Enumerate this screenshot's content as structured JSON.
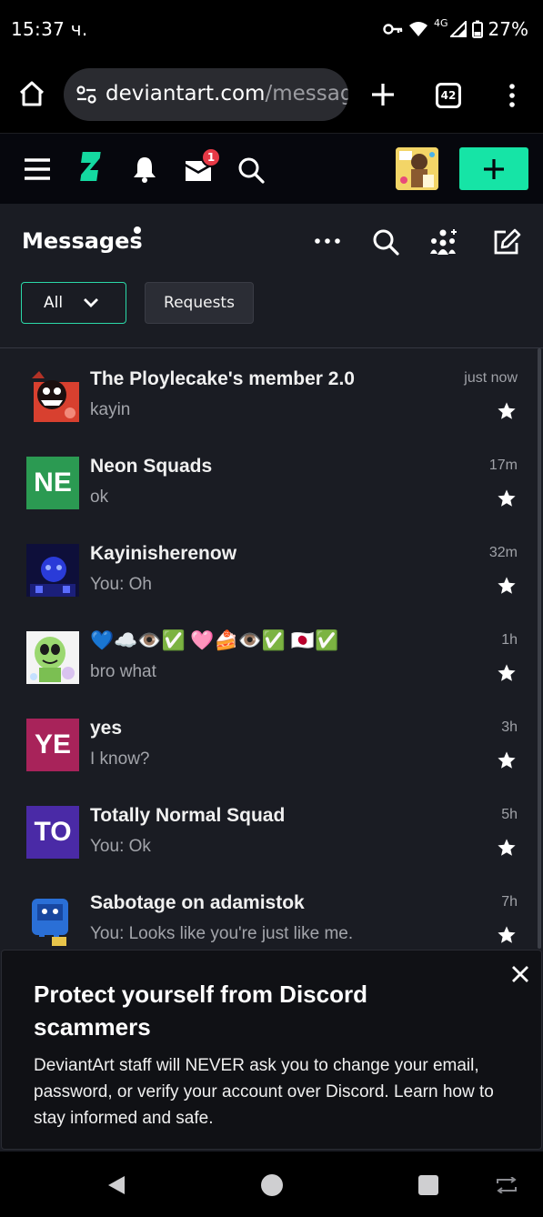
{
  "status": {
    "time": "15:37 ч.",
    "network": "4G",
    "battery": "27%"
  },
  "browser": {
    "url_domain": "deviantart.com",
    "url_path": "/message",
    "tab_count": "42"
  },
  "header": {
    "mail_badge": "1",
    "create_color": "#16e4a6"
  },
  "messages": {
    "title": "Messages",
    "filter_all": "All",
    "filter_requests": "Requests"
  },
  "conversations": [
    {
      "name": "The Ploylecake's member 2.0",
      "preview": "kayin",
      "time": "just now",
      "avatar": "image",
      "avatar_color": "#c83a2e"
    },
    {
      "name": "Neon Squads",
      "preview": "ok",
      "time": "17m",
      "avatar": "NE",
      "avatar_color": "#2b9a52"
    },
    {
      "name": "Kayinisherenow",
      "preview": "You: Oh",
      "time": "32m",
      "avatar": "image",
      "avatar_color": "#1c1f6e"
    },
    {
      "name": "💙☁️👁️✅ 🩷🍰👁️✅ 🇯🇵✅",
      "preview": "bro what",
      "time": "1h",
      "avatar": "image",
      "avatar_color": "#8fd16b"
    },
    {
      "name": "yes",
      "preview": "I know?",
      "time": "3h",
      "avatar": "YE",
      "avatar_color": "#a8235a"
    },
    {
      "name": "Totally Normal Squad",
      "preview": "You: Ok",
      "time": "5h",
      "avatar": "TO",
      "avatar_color": "#4a2aa6"
    },
    {
      "name": "Sabotage on adamistok",
      "preview": "You: Looks like you're just like me.",
      "time": "7h",
      "avatar": "image",
      "avatar_color": "#2a6fd6"
    }
  ],
  "banner": {
    "title": "Protect yourself from Discord scammers",
    "body": "DeviantArt staff will NEVER ask you to change your email, password, or verify your account over Discord. Learn how to stay informed and safe."
  }
}
